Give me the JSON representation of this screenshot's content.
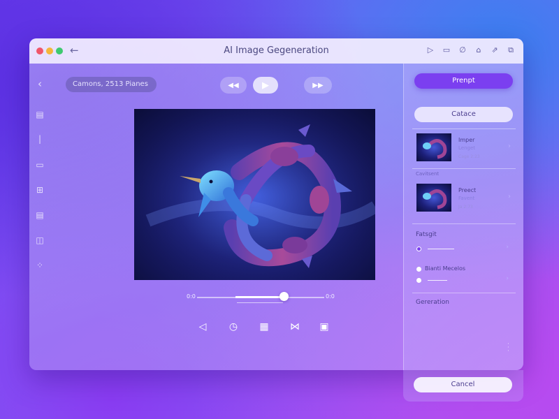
{
  "window": {
    "title": "AI Image Gegeneration"
  },
  "toolbar": {
    "back_icon": "arrow-left-icon",
    "right_icons": [
      "play-outline-icon",
      "clipboard-icon",
      "paperclip-icon",
      "home-icon",
      "share-icon",
      "export-icon"
    ]
  },
  "left_sidebar": {
    "icons": [
      "chevron-left-icon",
      "document-icon",
      "pen-icon",
      "briefcase-icon",
      "grid-icon",
      "page-icon",
      "image-icon",
      "dots-grid-icon"
    ]
  },
  "main": {
    "selection_label": "Camons, 2513 Pianes",
    "playback": {
      "rewind_icon": "rewind-icon",
      "play_icon": "play-icon",
      "forward_icon": "fast-forward-icon"
    },
    "timeline": {
      "start_label": "0:0",
      "end_label": "0:0",
      "progress": 0.6
    },
    "tools": [
      "triangle-pointer-icon",
      "clock-icon",
      "grid-tiles-icon",
      "share-nodes-icon",
      "frame-icon"
    ]
  },
  "right_panel": {
    "primary_button": "Prenpt",
    "secondary_button": "Catace",
    "cards": [
      {
        "title": "Imper",
        "subtitle": "Lenget",
        "meta": "Cage 2:23"
      },
      {
        "title": "Preect",
        "subtitle": "Favent",
        "meta": "Ja 2:73"
      }
    ],
    "cards_section_label": "Cavitsent",
    "settings_label": "Fatsgit",
    "options": [
      {
        "label": "",
        "selected": true
      },
      {
        "label": "Bianti Mecelos",
        "selected": false
      },
      {
        "label": "",
        "selected": false
      }
    ],
    "generation_label": "Gereration",
    "cancel_button": "Cancel"
  },
  "colors": {
    "accent": "#7b3ff0",
    "traffic_red": "#f0566a",
    "traffic_yellow": "#f4b63a",
    "traffic_green": "#3ec970"
  }
}
